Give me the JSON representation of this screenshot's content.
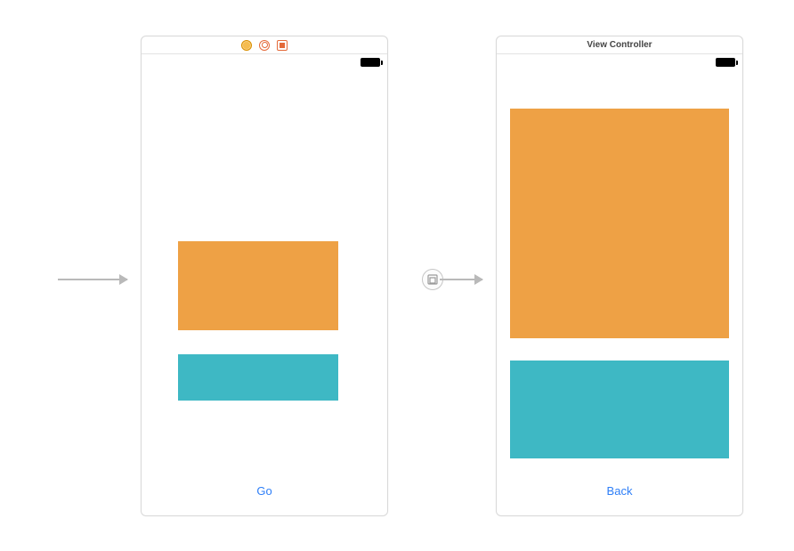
{
  "colors": {
    "orange": "#eea145",
    "teal": "#3eb8c4",
    "link": "#2d7ef7"
  },
  "scene_left": {
    "header_icons": [
      "yellow-dot",
      "orange-ring",
      "orange-square"
    ],
    "button_label": "Go"
  },
  "scene_right": {
    "title": "View Controller",
    "button_label": "Back"
  },
  "connections": {
    "initial_arrow": true,
    "segue_arrow": true,
    "segue_type": "present-modally"
  }
}
